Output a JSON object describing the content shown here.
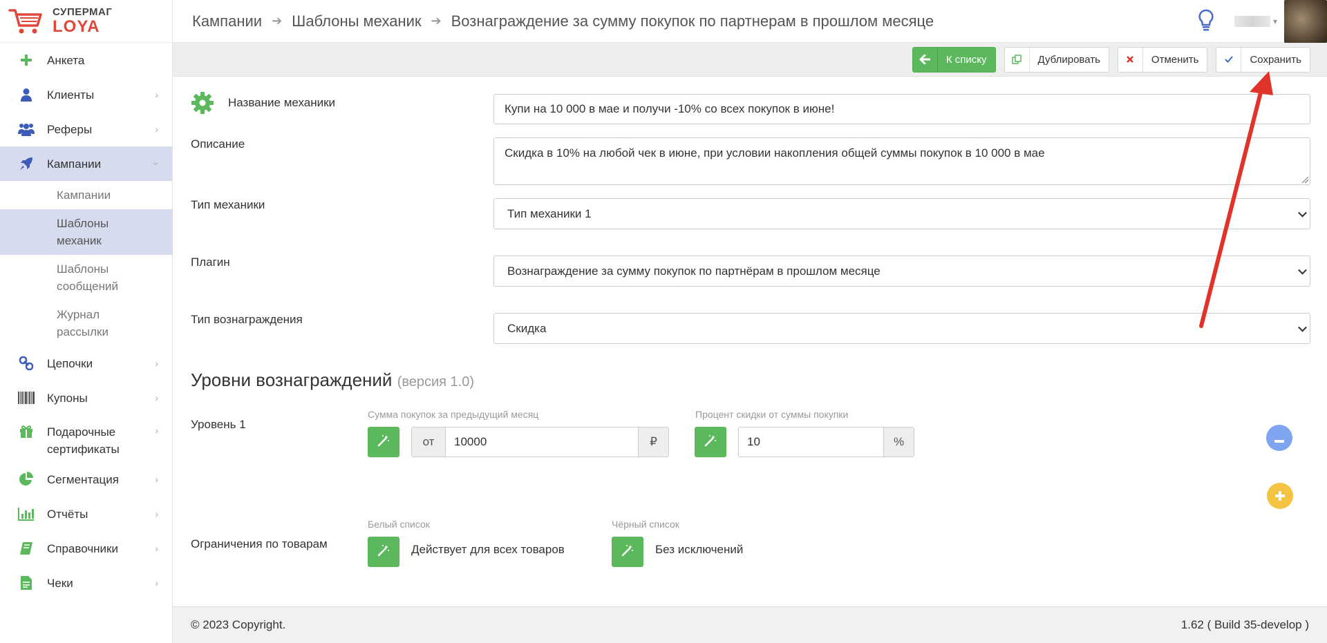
{
  "logo": {
    "top": "СУПЕРМАГ",
    "bottom": "LOYA"
  },
  "sidebar": {
    "items": [
      {
        "label": "Анкета"
      },
      {
        "label": "Клиенты"
      },
      {
        "label": "Реферы"
      },
      {
        "label": "Кампании"
      },
      {
        "label": "Цепочки"
      },
      {
        "label": "Купоны"
      },
      {
        "label": "Подарочные сертификаты"
      },
      {
        "label": "Сегментация"
      },
      {
        "label": "Отчёты"
      },
      {
        "label": "Справочники"
      },
      {
        "label": "Чеки"
      }
    ],
    "sub_items": [
      {
        "label": "Кампании"
      },
      {
        "label": "Шаблоны механик"
      },
      {
        "label": "Шаблоны сообщений"
      },
      {
        "label": "Журнал рассылки"
      }
    ]
  },
  "breadcrumb": [
    "Кампании",
    "Шаблоны механик",
    "Вознаграждение за сумму покупок по партнерам в прошлом месяце"
  ],
  "toolbar": {
    "back_label": "К списку",
    "duplicate_label": "Дублировать",
    "cancel_label": "Отменить",
    "save_label": "Сохранить"
  },
  "form": {
    "name_label": "Название механики",
    "name_value": "Купи на 10 000 в мае и получи -10% со всех покупок в июне!",
    "description_label": "Описание",
    "description_value": "Скидка в 10% на любой чек в июне, при условии накопления общей суммы покупок в 10 000 в мае",
    "type_label": "Тип механики",
    "type_value": "Тип механики 1",
    "plugin_label": "Плагин",
    "plugin_value": "Вознаграждение за сумму покупок по партнёрам в прошлом месяце",
    "reward_type_label": "Тип вознаграждения",
    "reward_type_value": "Скидка"
  },
  "levels": {
    "title": "Уровни вознаграждений",
    "version": "(версия 1.0)",
    "level1_label": "Уровень 1",
    "sum_label": "Сумма покупок за предыдущий месяц",
    "sum_prefix": "от",
    "sum_value": "10000",
    "sum_suffix": "₽",
    "percent_label": "Процент скидки от суммы покупки",
    "percent_value": "10",
    "percent_suffix": "%"
  },
  "restrictions": {
    "label": "Ограничения по товарам",
    "whitelist_label": "Белый список",
    "whitelist_value": "Действует для всех товаров",
    "blacklist_label": "Чёрный список",
    "blacklist_value": "Без исключений"
  },
  "footer": {
    "copyright": "© 2023 Copyright.",
    "version": "1.62 ( Build 35-develop )"
  },
  "colors": {
    "accent_green": "#5cb85c",
    "active_bg": "#d6dcee",
    "brand_red": "#e0463a",
    "minus_blue": "#7fa5f0",
    "plus_yellow": "#f5c342",
    "arrow_red": "#e0342a"
  }
}
